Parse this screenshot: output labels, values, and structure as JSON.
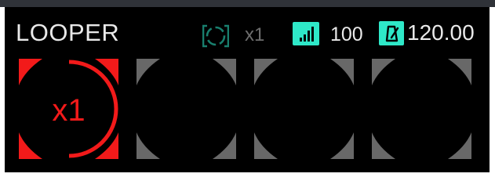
{
  "app": {
    "title": "LOOPER"
  },
  "status": {
    "loop_icon": "loop-cycle-icon",
    "multiplier": "x1",
    "signal_icon": "signal-level-icon",
    "signal_value": "100",
    "metronome_icon": "metronome-icon",
    "tempo": "120.00"
  },
  "slots": [
    {
      "label": "x1",
      "state": "active"
    },
    {
      "label": "",
      "state": "empty"
    },
    {
      "label": "",
      "state": "empty"
    },
    {
      "label": "",
      "state": "empty"
    }
  ],
  "colors": {
    "background": "#000000",
    "accent_active": "#f21a1a",
    "accent_teal": "#2ee8c8",
    "slot_inactive": "#686868",
    "text_primary": "#e9e9e9",
    "text_dim": "#6e6e6e"
  }
}
